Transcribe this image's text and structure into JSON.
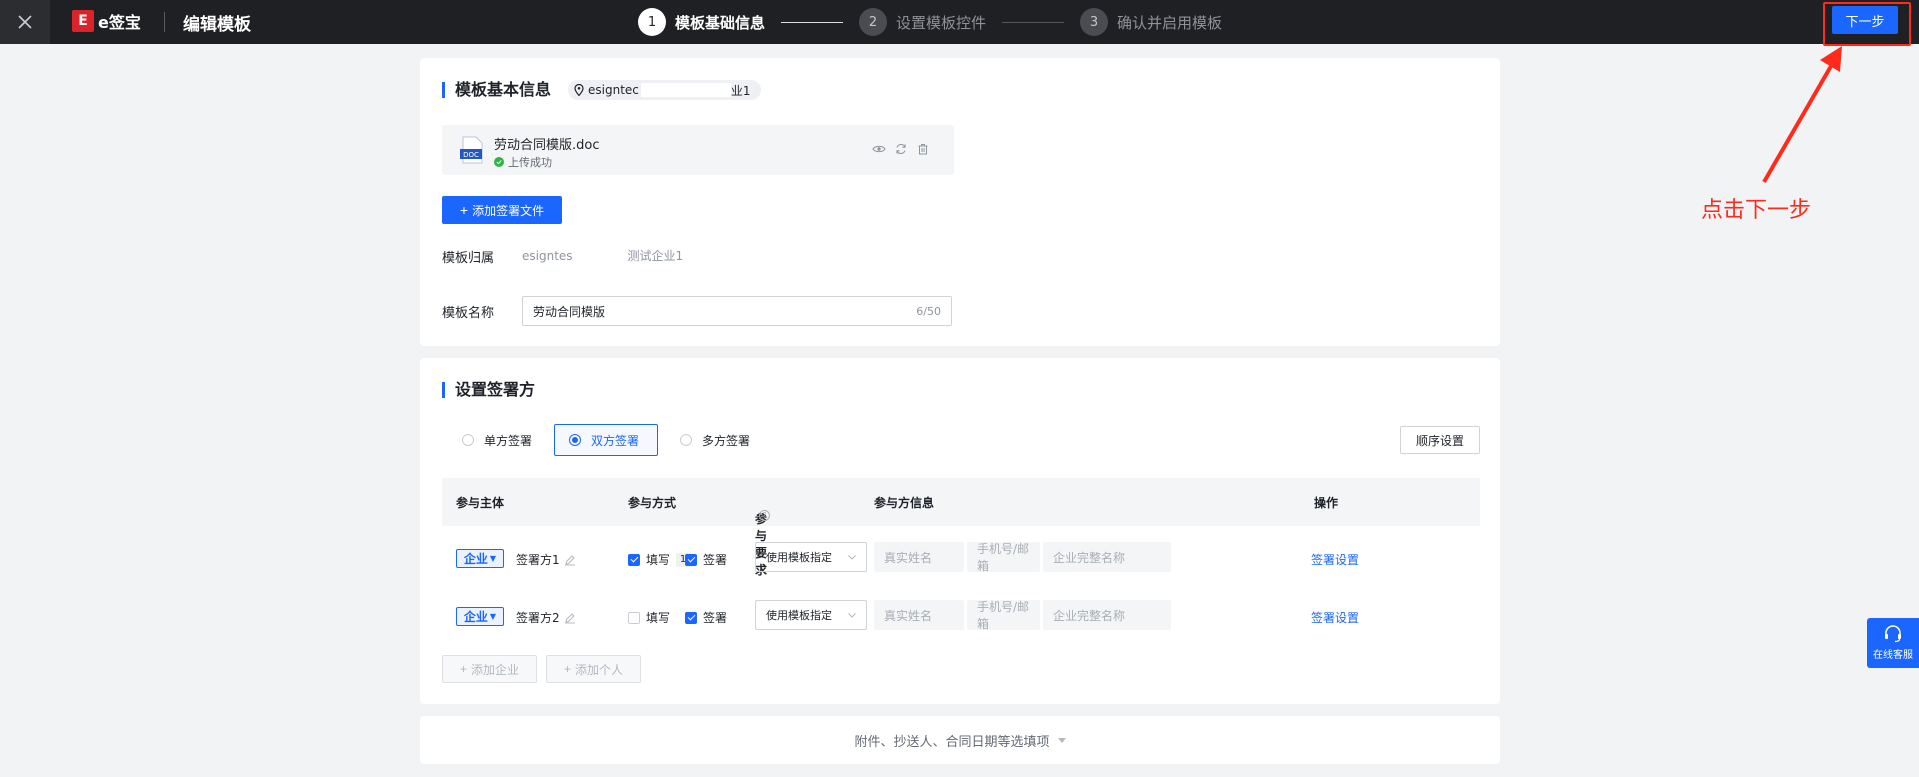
{
  "header": {
    "brand": "e签宝",
    "title": "编辑模板",
    "steps": [
      {
        "num": "1",
        "label": "模板基础信息"
      },
      {
        "num": "2",
        "label": "设置模板控件"
      },
      {
        "num": "3",
        "label": "确认并启用模板"
      }
    ],
    "next_label": "下一步"
  },
  "annotation": {
    "text": "点击下一步"
  },
  "basic_info": {
    "title": "模板基本信息",
    "org_tag_prefix": "esigntec",
    "org_tag_suffix": "业1",
    "file": {
      "name": "劳动合同模版.doc",
      "status": "上传成功",
      "icon_text": "DOC"
    },
    "add_file_label": "添加签署文件",
    "owner_label": "模板归属",
    "owner_prefix": "esigntes",
    "owner_suffix": "测试企业1",
    "name_label": "模板名称",
    "name_value": "劳动合同模版",
    "name_counter": "6/50"
  },
  "signers": {
    "title": "设置签署方",
    "modes": [
      "单方签署",
      "双方签署",
      "多方签署"
    ],
    "selected_mode": "双方签署",
    "order_label": "顺序设置",
    "columns": [
      "参与主体",
      "参与方式",
      "参与要求",
      "参与方信息",
      "操作"
    ],
    "rows": [
      {
        "type": "企业",
        "name": "签署方1",
        "fill": "填写",
        "fill_checked": true,
        "fill_badge": "1",
        "sign": "签署",
        "sign_checked": true,
        "requirement": "使用模板指定",
        "ph_name": "真实姓名",
        "ph_contact": "手机号/邮箱",
        "ph_company": "企业完整名称",
        "action": "签署设置"
      },
      {
        "type": "企业",
        "name": "签署方2",
        "fill": "填写",
        "fill_checked": false,
        "fill_badge": "",
        "sign": "签署",
        "sign_checked": true,
        "requirement": "使用模板指定",
        "ph_name": "真实姓名",
        "ph_contact": "手机号/邮箱",
        "ph_company": "企业完整名称",
        "action": "签署设置"
      }
    ],
    "add_company_label": "添加企业",
    "add_person_label": "添加个人"
  },
  "optional": {
    "label": "附件、抄送人、合同日期等选填项"
  },
  "service": {
    "label": "在线客服"
  },
  "colors": {
    "accent": "#1a66ff",
    "topbar": "#1f2023",
    "annotation": "#ff2a1a"
  }
}
